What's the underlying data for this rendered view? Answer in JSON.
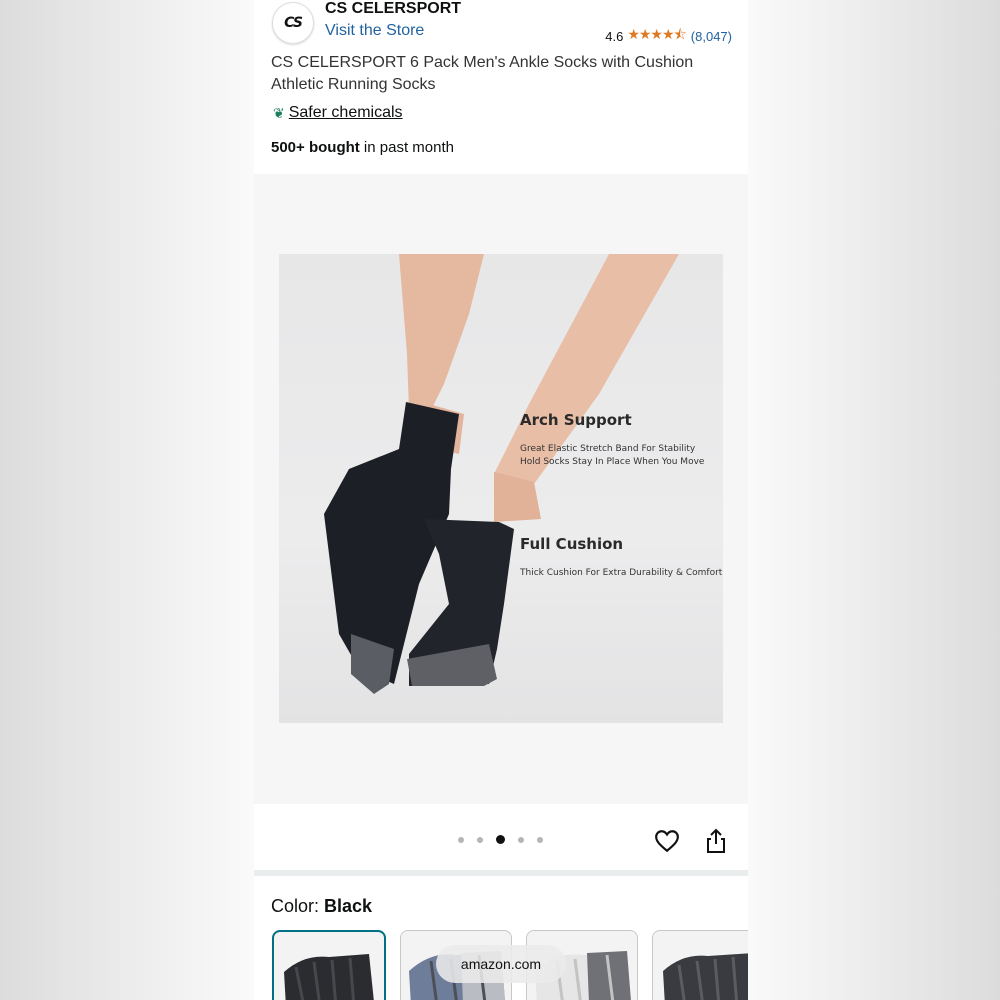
{
  "header": {
    "logo_text": "CS",
    "brand_name": "CS CELERSPORT",
    "visit_store": "Visit the Store",
    "rating": "4.6",
    "stars_icon": "star-rating-icon",
    "review_count": "(8,047)"
  },
  "product": {
    "title": "CS CELERSPORT 6 Pack Men's Ankle Socks with Cushion Athletic Running Socks",
    "safer_chemicals": "Safer chemicals",
    "bought_bold": "500+ bought",
    "bought_rest": " in past month"
  },
  "image": {
    "annotation_1_title": "Arch Support",
    "annotation_1_line1": "Great Elastic Stretch Band For Stability",
    "annotation_1_line2": "Hold Socks Stay In Place When You Move",
    "annotation_2_title": "Full Cushion",
    "annotation_2_line1": "Thick Cushion For Extra Durability & Comfort",
    "carousel": {
      "total": 5,
      "active_index": 3
    }
  },
  "color": {
    "label": "Color: ",
    "value": "Black"
  },
  "bottom_pill": "amazon.com",
  "colors": {
    "link": "#2162a1",
    "star": "#de7921",
    "selected_border": "#007185"
  }
}
